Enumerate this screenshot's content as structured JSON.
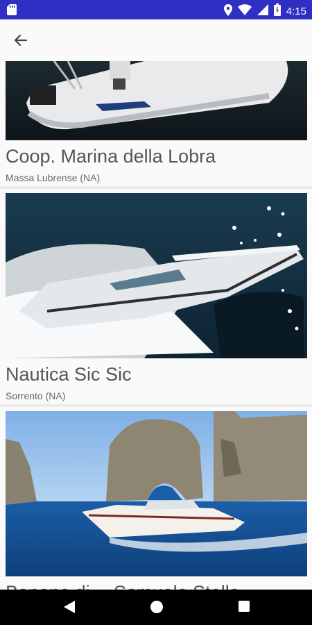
{
  "status_bar": {
    "time": "4:15",
    "icons": [
      "sd-card-icon",
      "location-icon",
      "wifi-icon",
      "signal-icon",
      "battery-icon"
    ]
  },
  "app_bar": {
    "back_icon": "arrow-left-icon"
  },
  "listings": [
    {
      "title": "Coop. Marina della Lobra",
      "location": "Massa Lubrense (NA)",
      "image": "white-rib-boat-photo"
    },
    {
      "title": "Nautica Sic Sic",
      "location": "Sorrento (NA)",
      "image": "speedboat-photo"
    },
    {
      "title": "Banana di… Samuele Stella",
      "location": "",
      "image": "capri-faraglioni-boat-photo"
    }
  ],
  "nav_bar": {
    "icons": [
      "back-triangle-icon",
      "home-circle-icon",
      "recents-square-icon"
    ]
  },
  "colors": {
    "status_bar": "#2f2fc4",
    "background": "#fafafa",
    "title_text": "#555555"
  }
}
